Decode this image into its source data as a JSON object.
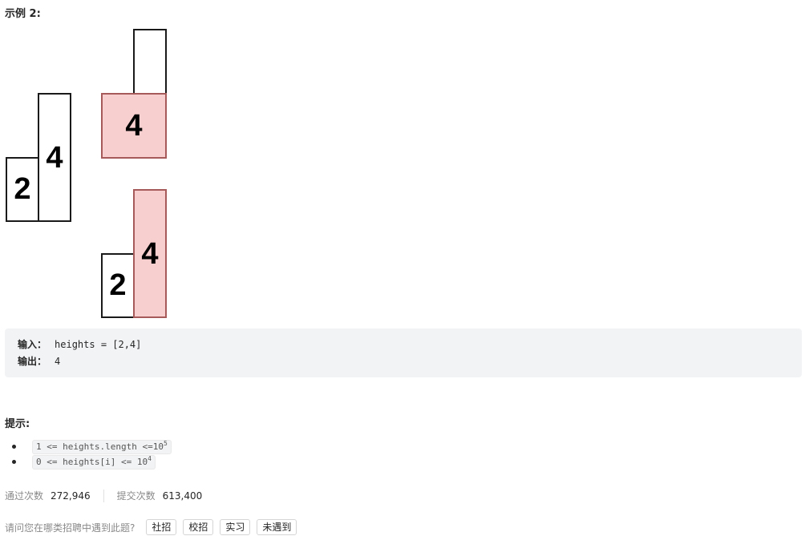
{
  "example": {
    "title": "示例 2:",
    "figure": {
      "left_group": [
        "2",
        "4"
      ],
      "top_right": "4",
      "bottom_right": [
        "2",
        "4"
      ]
    },
    "input_label": "输入：",
    "input_value": "heights = [2,4]",
    "output_label": "输出：",
    "output_value": "4"
  },
  "hints": {
    "title": "提示:",
    "items": [
      {
        "text": "1 <= heights.length <=10",
        "sup": "5"
      },
      {
        "text": "0 <= heights[i] <= 10",
        "sup": "4"
      }
    ]
  },
  "stats": {
    "accepted_label": "通过次数",
    "accepted_value": "272,946",
    "submitted_label": "提交次数",
    "submitted_value": "613,400"
  },
  "interview": {
    "question": "请问您在哪类招聘中遇到此题?",
    "options": [
      "社招",
      "校招",
      "实习",
      "未遇到"
    ]
  }
}
